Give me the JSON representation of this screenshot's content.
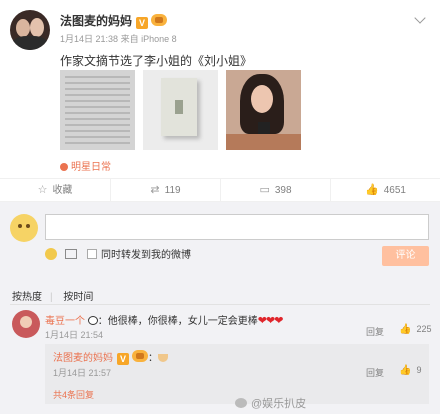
{
  "post": {
    "author": "法图麦的妈妈",
    "verified_badge": "V",
    "time": "1月14日 21:38",
    "source": "来自 iPhone 8",
    "text": "作家文摘节选了李小姐的《刘小姐》",
    "topic_tag": "明星日常",
    "images": [
      "newspaper-page",
      "book-cover",
      "woman-with-phone"
    ]
  },
  "actions": {
    "favorite_label": "收藏",
    "repost_count": "119",
    "comment_count": "398",
    "like_count": "4651"
  },
  "composer": {
    "placeholder": "",
    "repost_checkbox_label": "同时转发到我的微博",
    "send_label": "评论"
  },
  "sort_tabs": {
    "hot": "按热度",
    "time": "按时间",
    "separator": "|"
  },
  "comment": {
    "author": "毒豆一个",
    "text": "：他很棒，你很棒，女儿一定会更棒",
    "hearts": "❤❤❤",
    "time": "1月14日 21:54",
    "reply_label": "回复",
    "like_count": "225"
  },
  "sub_comment": {
    "author": "法图麦的妈妈",
    "badge": "V",
    "separator": "：",
    "time": "1月14日 21:57",
    "reply_label": "回复",
    "like_count": "9",
    "more_replies": "共4条回复"
  },
  "watermark": "@娱乐扒皮",
  "colors": {
    "accent": "#eb7350",
    "badge": "#f7a628",
    "send_button": "#ffc09f",
    "comment_area_bg": "#f2f2f5"
  }
}
